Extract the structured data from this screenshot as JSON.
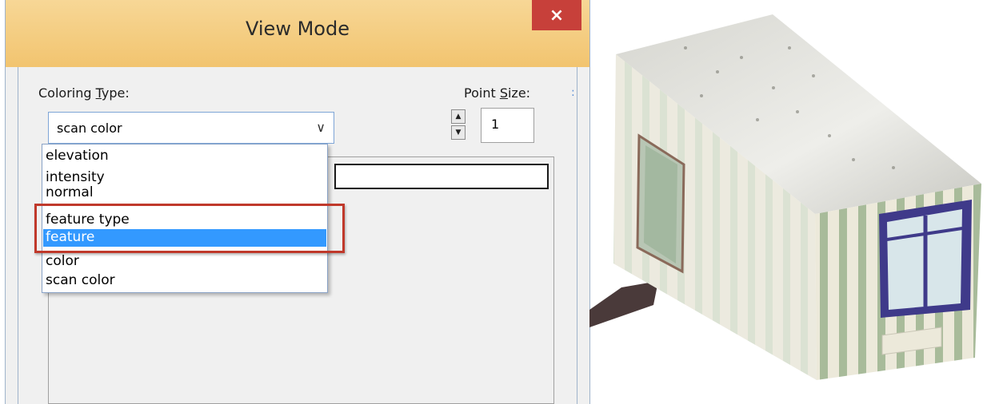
{
  "dialog": {
    "title": "View Mode",
    "close_label": "×",
    "coloring_type_label_pre": "Coloring ",
    "coloring_type_label_u": "T",
    "coloring_type_label_post": "ype:",
    "point_size_label_pre": "Point ",
    "point_size_label_u": "S",
    "point_size_label_post": "ize:",
    "point_size_value": "1",
    "coloring_type_value": "scan color",
    "combo_arrow": "∨",
    "spin_up": "▲",
    "spin_down": "▼",
    "separator": ":"
  },
  "dropdown": {
    "options": [
      {
        "label": "elevation",
        "selected": false
      },
      {
        "label": "intensity",
        "selected": false
      },
      {
        "label": "normal",
        "selected": false
      },
      {
        "label": "feature type",
        "selected": false
      },
      {
        "label": "feature",
        "selected": true
      },
      {
        "label": "color",
        "selected": false
      },
      {
        "label": "scan color",
        "selected": false
      }
    ]
  },
  "colors": {
    "title_bar": "#f2c46f",
    "close_button": "#c7403a",
    "selection": "#3399ff",
    "annotation_box": "#c0392b"
  }
}
